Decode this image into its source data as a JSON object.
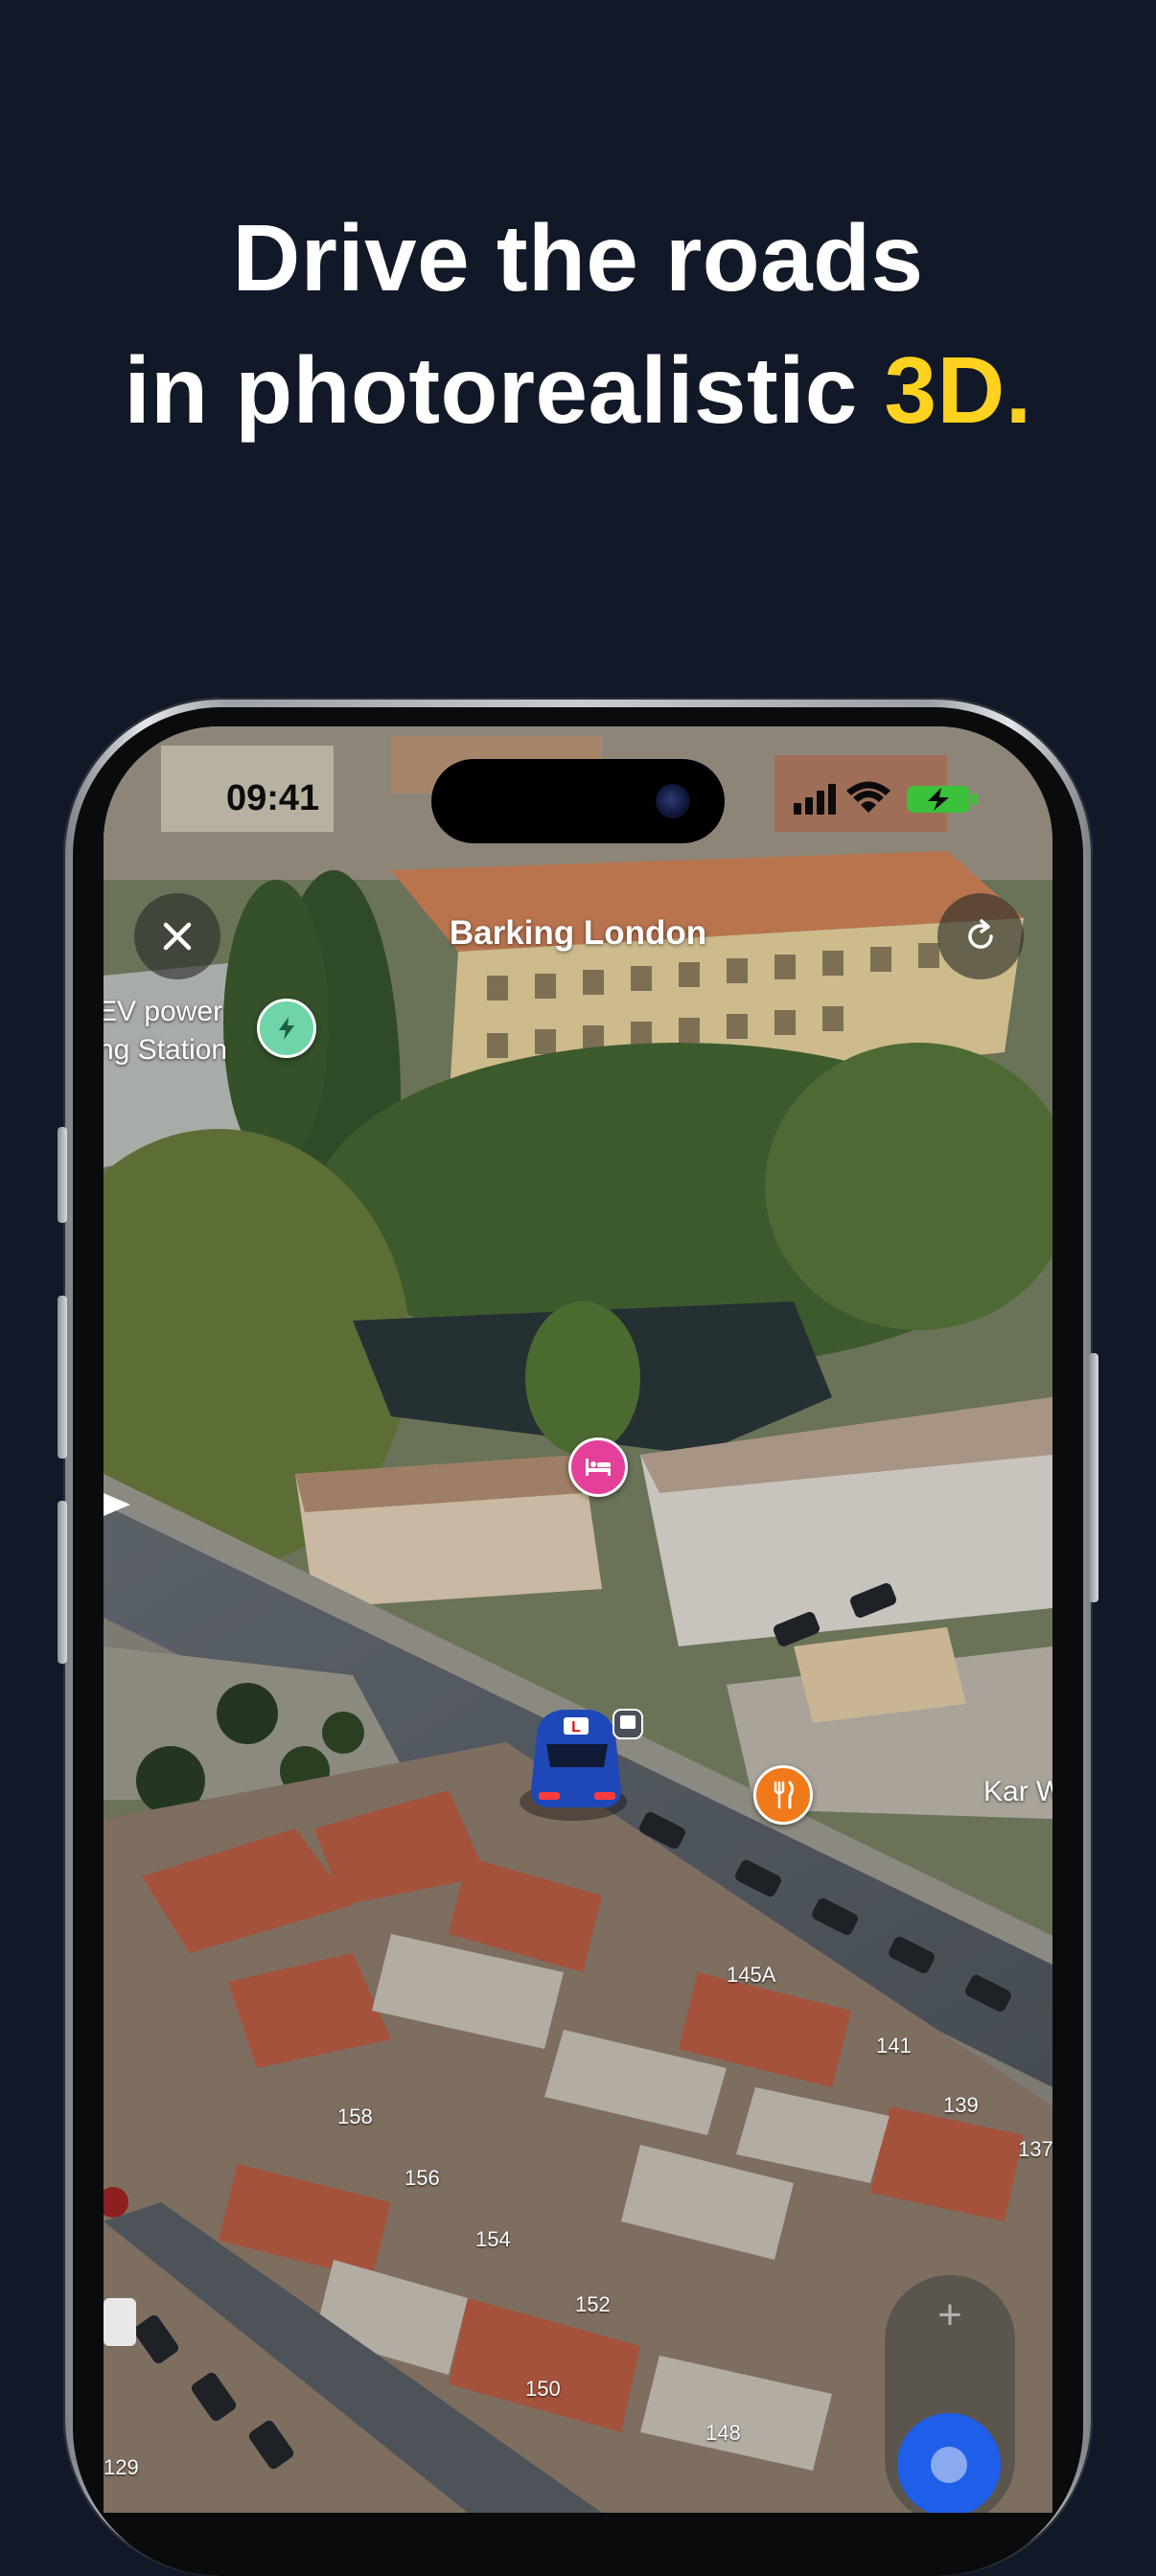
{
  "headline": {
    "line1": "Drive the roads",
    "line2_prefix": "in photorealistic ",
    "line2_accent": "3D."
  },
  "colors": {
    "background": "#111827",
    "accent": "#FFD21F",
    "locate_button": "#1f5ee8",
    "ev_pin": "#6fd4a8",
    "hotel_pin": "#e4409a",
    "restaurant_pin": "#f07a1a"
  },
  "status_bar": {
    "time": "09:41",
    "icons": [
      "signal-icon",
      "wifi-icon",
      "battery-charging-icon"
    ]
  },
  "map": {
    "title": "Barking London",
    "close_icon": "close-icon",
    "refresh_icon": "refresh-icon",
    "pois": [
      {
        "label": "EV power\nng Station",
        "icon": "ev-charging-icon"
      },
      {
        "label": "",
        "icon": "hotel-bed-icon"
      },
      {
        "label": "Kar W",
        "icon": "restaurant-icon"
      }
    ],
    "house_numbers": [
      "145A",
      "141",
      "139",
      "137",
      "158",
      "156",
      "154",
      "152",
      "150",
      "148",
      "129"
    ],
    "controls": {
      "zoom_in": "+",
      "locate_icon": "locate-icon"
    },
    "vehicle": "learner-car"
  }
}
